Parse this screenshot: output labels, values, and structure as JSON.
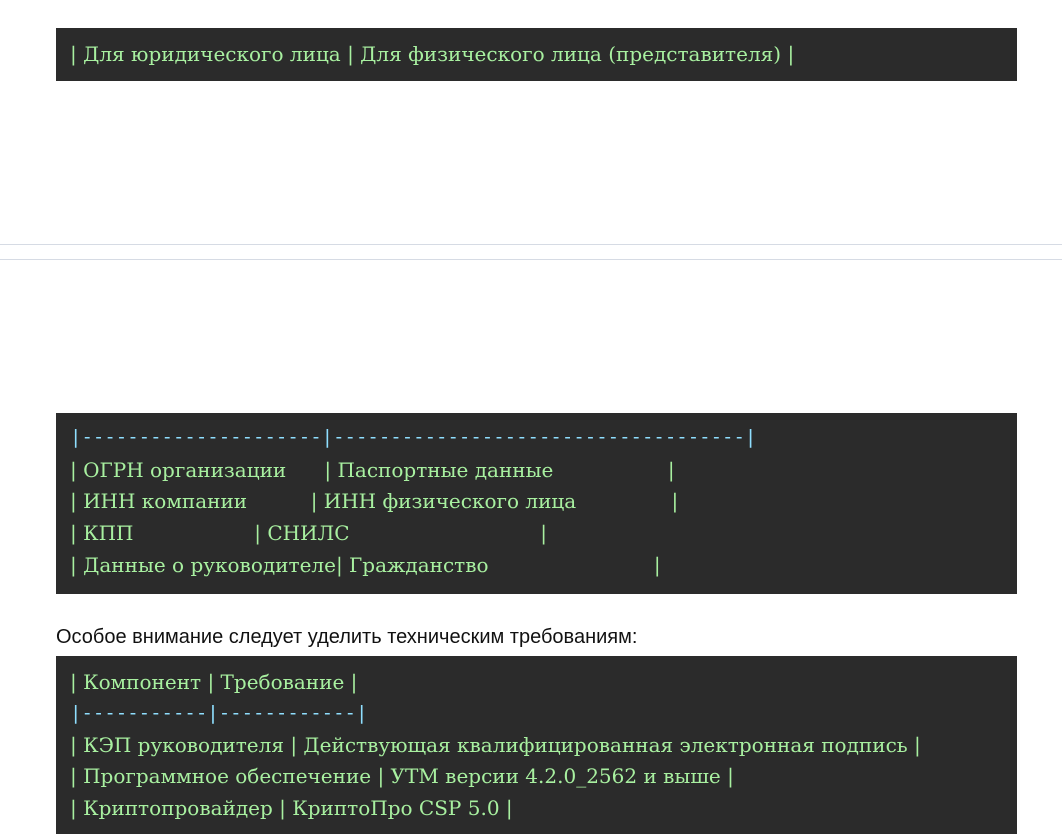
{
  "block1": {
    "line1": "| Для юридического лица | Для физического лица (представителя) |"
  },
  "block2": {
    "lines": [
      "|---------------------|------------------------------------|",
      "| ОГРН организации      | Паспортные данные                  |",
      "| ИНН компании          | ИНН физического лица               |",
      "| КПП                   | СНИЛС                              |",
      "| Данные о руководителе| Гражданство                          |"
    ]
  },
  "paragraph": {
    "text": "Особое внимание следует уделить техническим требованиям:"
  },
  "block3": {
    "lines": [
      "| Компонент | Требование |",
      "|-----------|------------|",
      "| КЭП руководителя | Действующая квалифицированная электронная подпись |",
      "| Программное обеспечение | УТМ версии 4.2.0_2562 и выше |",
      "| Криптопровайдер | КриптоПро CSP 5.0 |"
    ]
  }
}
